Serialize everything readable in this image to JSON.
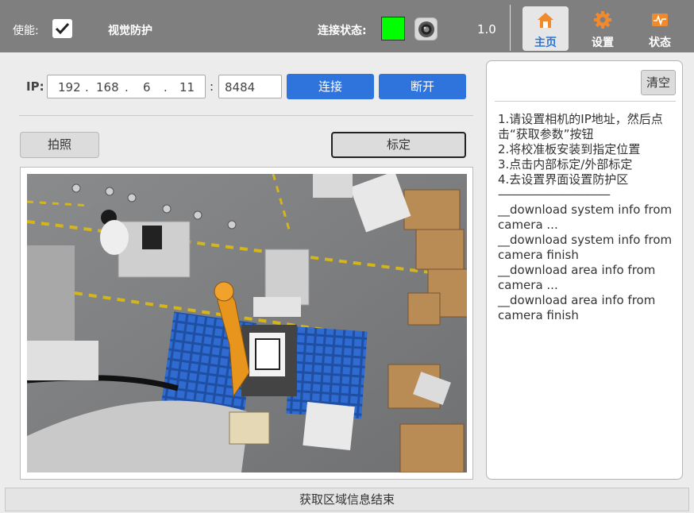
{
  "topbar": {
    "enable_label": "使能:",
    "enable_checked": true,
    "vision_label": "视觉防护",
    "connection_label": "连接状态:",
    "connection_color": "#00ff00",
    "camera_icon": "camera-icon",
    "version": "1.0",
    "tabs": [
      {
        "label": "主页",
        "icon": "home-icon",
        "active": true
      },
      {
        "label": "设置",
        "icon": "gear-icon",
        "active": false
      },
      {
        "label": "状态",
        "icon": "status-icon",
        "active": false
      }
    ]
  },
  "connection": {
    "ip_label": "IP:",
    "ip": [
      "192",
      "168",
      "6",
      "11"
    ],
    "port": "8484",
    "connect_label": "连接",
    "disconnect_label": "断开"
  },
  "actions": {
    "photo_label": "拍照",
    "calibrate_label": "标定"
  },
  "log": {
    "clear_label": "清空",
    "lines": [
      "1.请设置相机的IP地址，然后点击“获取参数”按钮",
      "2.将校准板安装到指定位置",
      "3.点击内部标定/外部标定",
      "4.去设置界面设置防护区",
      "--------------------------------------------",
      "__download system info from camera ...",
      "__download system info from camera finish",
      "__download area info from camera ...",
      "__download area info from camera finish"
    ]
  },
  "statusbar": {
    "text": "获取区域信息结束"
  },
  "colors": {
    "accent": "#2f74dd",
    "topbar": "#7f7f7f",
    "active_tab": "#2e74d6",
    "icon_orange": "#f08a2c"
  }
}
